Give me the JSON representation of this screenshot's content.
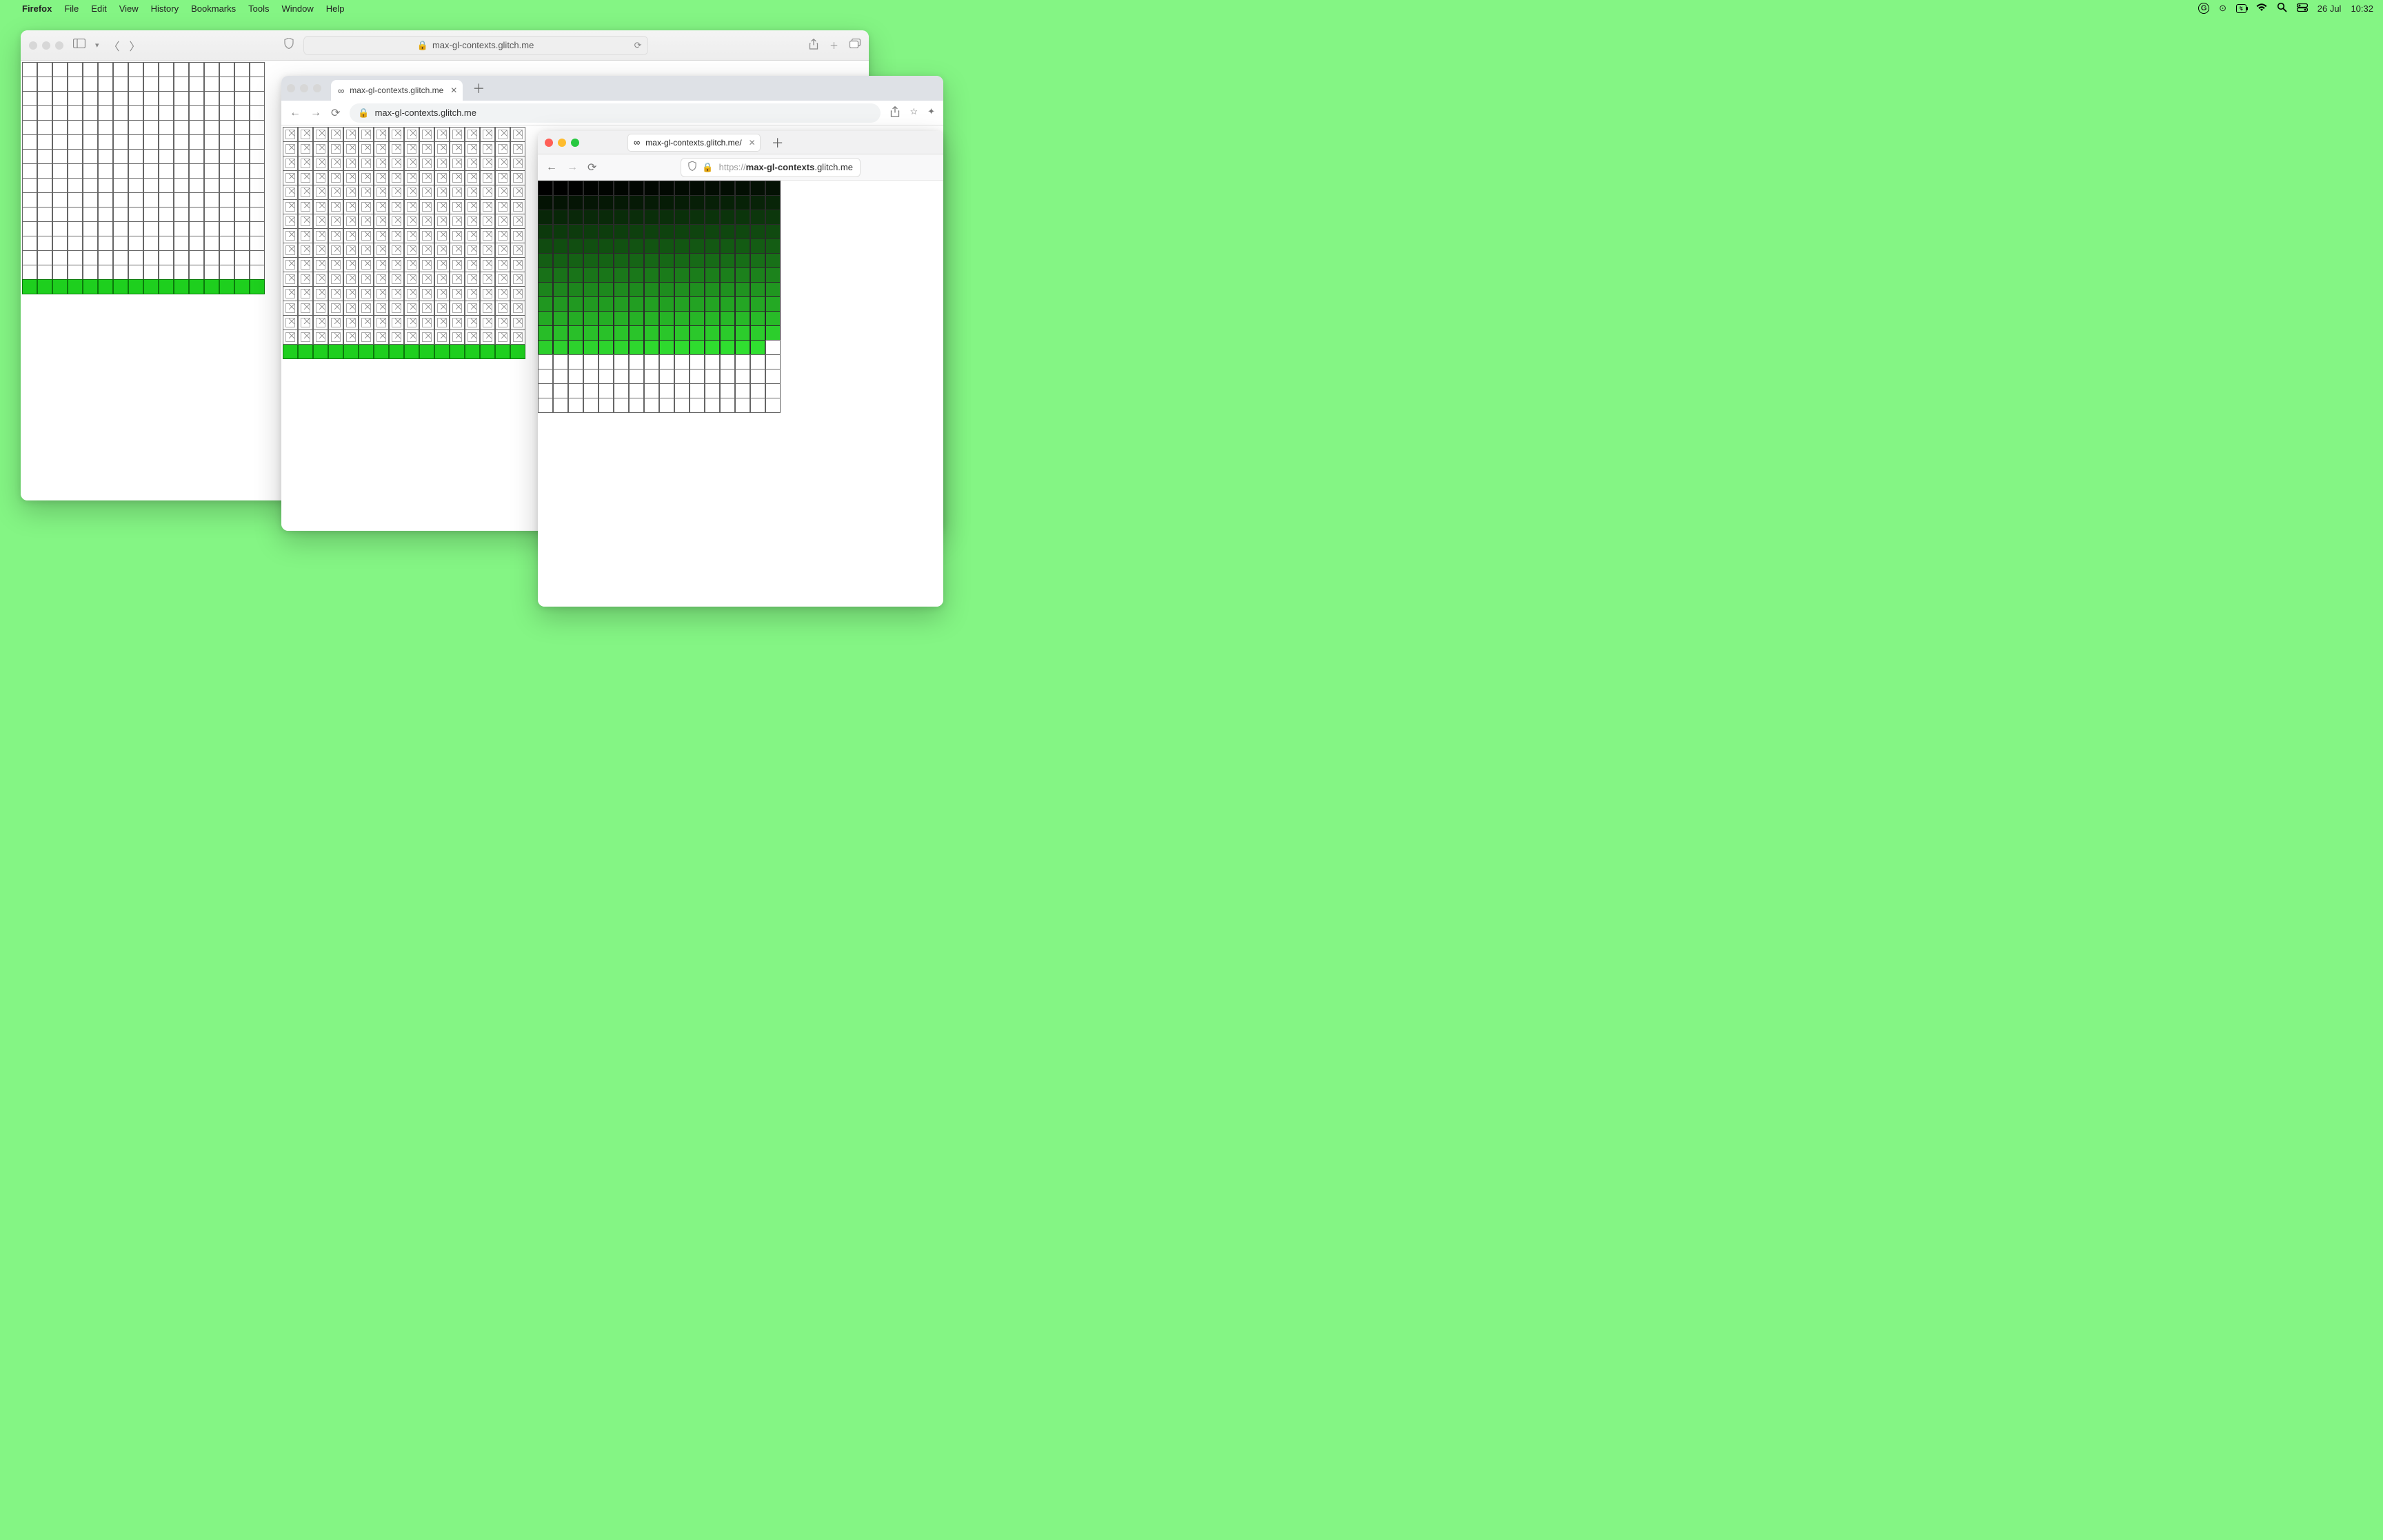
{
  "menubar": {
    "app": "Firefox",
    "items": [
      "File",
      "Edit",
      "View",
      "History",
      "Bookmarks",
      "Tools",
      "Window",
      "Help"
    ],
    "date": "26 Jul",
    "time": "10:32",
    "battery_label": "↯"
  },
  "safari": {
    "url_host": "max-gl-contexts.glitch.me",
    "lock": "🔒",
    "grid": {
      "cols": 16,
      "rows": 16,
      "green_rows": [
        15
      ]
    }
  },
  "chrome": {
    "tab_title": "max-gl-contexts.glitch.me",
    "tab_icon": "∞",
    "url_host": "max-gl-contexts.glitch.me",
    "grid": {
      "cols": 16,
      "rows": 16,
      "broken_rows": 15,
      "green_rows": [
        15
      ]
    }
  },
  "firefox": {
    "tab_title": "max-gl-contexts.glitch.me/",
    "tab_icon": "∞",
    "url_scheme": "https://",
    "url_bold": "max-gl-contexts",
    "url_rest": ".glitch.me",
    "grid": {
      "cols": 16,
      "filled_cells": 191,
      "total_rows": 16,
      "gradient_from": "#000000",
      "gradient_to": "#30e030"
    }
  }
}
